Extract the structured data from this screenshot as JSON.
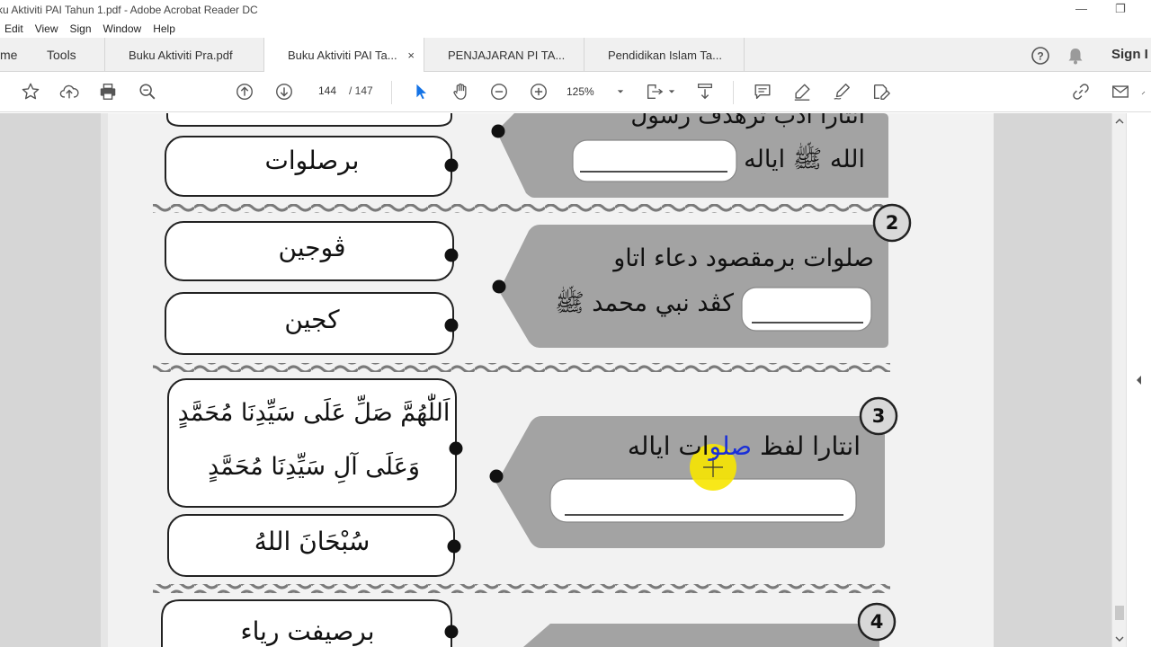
{
  "window": {
    "title": "ku Aktiviti PAI Tahun 1.pdf - Adobe Acrobat Reader DC",
    "minimize_glyph": "—",
    "restore_glyph": "❐"
  },
  "menu": [
    "Edit",
    "View",
    "Sign",
    "Window",
    "Help"
  ],
  "tabs": {
    "home": "me",
    "tools": "Tools",
    "items": [
      {
        "label": "Buku Aktiviti Pra.pdf"
      },
      {
        "label": "Buku Aktiviti PAI Ta...",
        "close": "×"
      },
      {
        "label": "PENJAJARAN PI TA..."
      },
      {
        "label": "Pendidikan Islam Ta..."
      }
    ],
    "sign_in": "Sign I"
  },
  "toolbar": {
    "current_page": "144",
    "page_total": "/ 147",
    "zoom": "125%"
  },
  "colors": {
    "pill_fill": "#a3a3a3",
    "highlight": "#f7e600",
    "blue_word": "#1a2fd8"
  },
  "worksheet": {
    "q1": {
      "top_fragment": "انتارا ادب ترهدڤ رسول",
      "line2": "الله ﷺ اياله"
    },
    "q2": {
      "number": "2",
      "line1": "صلوات برمقصود دعاء اتاو",
      "line2": "كڤد نبي محمد ﷺ"
    },
    "q3": {
      "number": "3",
      "line1_a": "انتارا لفظ ",
      "line1_blue": "صلو",
      "line1_b": "ات اياله"
    },
    "q4": {
      "number": "4"
    },
    "options": [
      {
        "text": "برصلوات"
      },
      {
        "text": "ڤوجين"
      },
      {
        "text": "كجين"
      },
      {
        "line1": "اَللّٰهُمَّ صَلِّ عَلَى سَيِّدِنَا مُحَمَّدٍ",
        "line2": "وَعَلَى آلِ سَيِّدِنَا مُحَمَّدٍ"
      },
      {
        "text": "سُبْحَانَ اللهُ"
      },
      {
        "text": "برصيفت رياء"
      }
    ]
  }
}
